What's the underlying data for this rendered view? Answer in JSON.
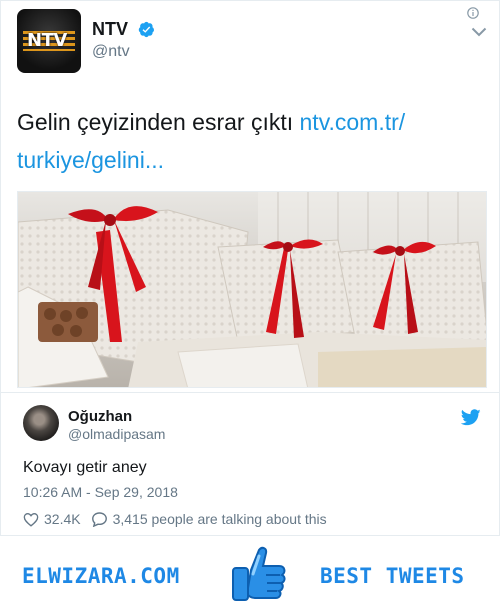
{
  "tweet": {
    "author_name": "NTV",
    "author_handle": "@ntv",
    "avatar_logo_text": "NTV",
    "text_plain": "Gelin çeyizinden esrar çıktı ",
    "link_text": "ntv.com.tr/ turkiye/gelini...",
    "icons": {
      "verified": "verified-badge-icon",
      "info": "info-icon",
      "menu": "chevron-down-icon"
    }
  },
  "quoted": {
    "name": "Oğuzhan",
    "handle": "@olmadipasam",
    "text": "Kovayı getir aney",
    "timestamp": "10:26 AM - Sep 29, 2018",
    "likes": "32.4K",
    "talking": "3,415 people are talking about this",
    "icons": {
      "platform": "twitter-bird-icon",
      "like": "heart-icon",
      "comment": "comment-icon"
    }
  },
  "footer": {
    "brand_left": "ELWIZARA.COM",
    "brand_right": "BEST TWEETS",
    "icon": "thumbs-up-icon"
  },
  "colors": {
    "link": "#1b95e0",
    "verified": "#1da1f2",
    "brand": "#1e88e5",
    "ribbon": "#d8141c",
    "muted": "#657786"
  }
}
